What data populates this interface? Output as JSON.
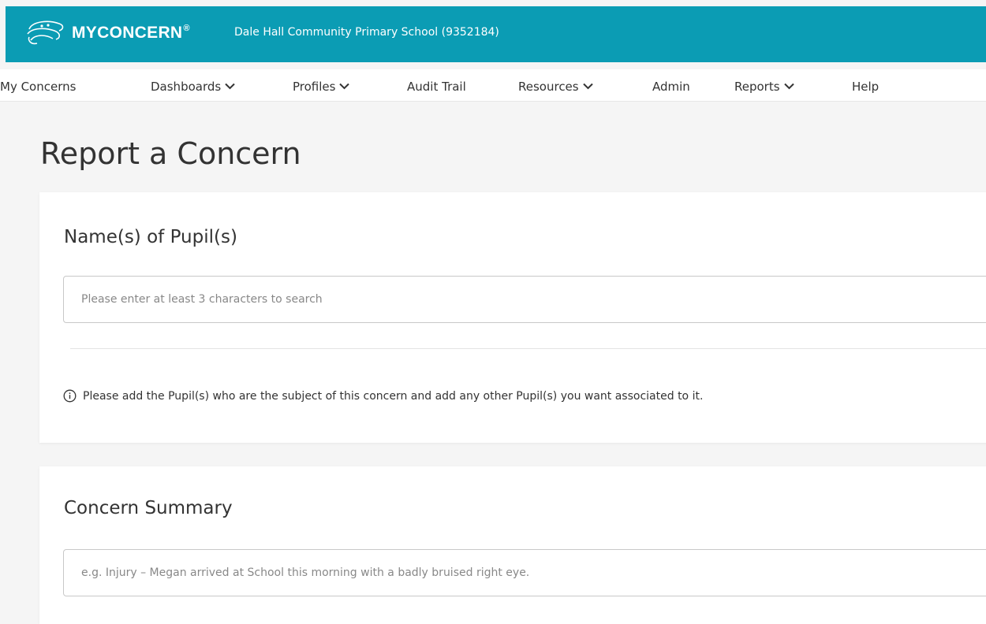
{
  "header": {
    "brand": "MYCONCERN",
    "brand_mark": "®",
    "school": "Dale Hall Community Primary School (9352184)",
    "background_color": "#0b9cb4",
    "logo_icon": "myconcern-logo-icon"
  },
  "nav": {
    "items": [
      {
        "label": "My Concerns",
        "has_dropdown": false
      },
      {
        "label": "Dashboards",
        "has_dropdown": true
      },
      {
        "label": "Profiles",
        "has_dropdown": true
      },
      {
        "label": "Audit Trail",
        "has_dropdown": false
      },
      {
        "label": "Resources",
        "has_dropdown": true
      },
      {
        "label": "Admin",
        "has_dropdown": false
      },
      {
        "label": "Reports",
        "has_dropdown": true
      },
      {
        "label": "Help",
        "has_dropdown": false
      }
    ]
  },
  "page": {
    "title": "Report a Concern"
  },
  "pupils_section": {
    "heading": "Name(s) of Pupil(s)",
    "search_placeholder": "Please enter at least 3 characters to search",
    "info_text": "Please add the Pupil(s) who are the subject of this concern and add any other Pupil(s) you want associated to it.",
    "info_icon": "info-circle-icon"
  },
  "summary_section": {
    "heading": "Concern Summary",
    "placeholder": "e.g. Injury – Megan arrived at School this morning with a badly bruised right eye."
  }
}
